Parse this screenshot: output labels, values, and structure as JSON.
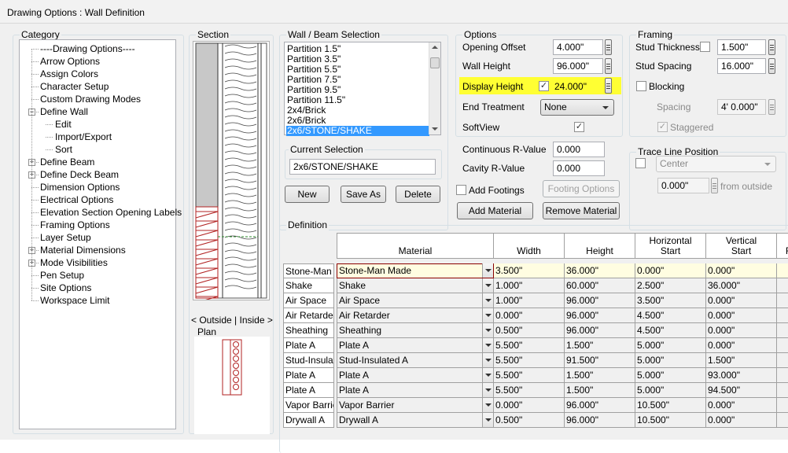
{
  "window": {
    "title": "Drawing Options : Wall Definition"
  },
  "category": {
    "label": "Category",
    "items": [
      {
        "label": "----Drawing Options----",
        "expandable": false
      },
      {
        "label": "Arrow Options",
        "expandable": false
      },
      {
        "label": "Assign Colors",
        "expandable": false
      },
      {
        "label": "Character Setup",
        "expandable": false
      },
      {
        "label": "Custom Drawing Modes",
        "expandable": false
      },
      {
        "label": "Define Wall",
        "expandable": true,
        "expanded": true
      },
      {
        "label": "Edit",
        "expandable": false,
        "child": true
      },
      {
        "label": "Import/Export",
        "expandable": false,
        "child": true
      },
      {
        "label": "Sort",
        "expandable": false,
        "child": true
      },
      {
        "label": "Define Beam",
        "expandable": true
      },
      {
        "label": "Define Deck Beam",
        "expandable": true
      },
      {
        "label": "Dimension Options",
        "expandable": false
      },
      {
        "label": "Electrical Options",
        "expandable": false
      },
      {
        "label": "Elevation Section Opening Labels",
        "expandable": false
      },
      {
        "label": "Framing Options",
        "expandable": false
      },
      {
        "label": "Layer Setup",
        "expandable": false
      },
      {
        "label": "Material Dimensions",
        "expandable": true
      },
      {
        "label": "Mode Visibilities",
        "expandable": true
      },
      {
        "label": "Pen Setup",
        "expandable": false
      },
      {
        "label": "Site Options",
        "expandable": false
      },
      {
        "label": "Workspace Limit",
        "expandable": false
      }
    ]
  },
  "section": {
    "label": "Section",
    "outside_inside": "< Outside  |  Inside >",
    "plan_label": "Plan"
  },
  "wall_beam": {
    "label": "Wall / Beam Selection",
    "items": [
      "Partition 1.5\"",
      "Partition 3.5\"",
      "Partition 5.5\"",
      "Partition 7.5\"",
      "Partition 9.5\"",
      "Partition 11.5\"",
      "2x4/Brick",
      "2x6/Brick",
      "2x6/STONE/SHAKE"
    ],
    "selected_index": 8,
    "current_selection_label": "Current Selection",
    "current_selection_value": "2x6/STONE/SHAKE",
    "new_label": "New",
    "save_as_label": "Save As",
    "delete_label": "Delete"
  },
  "options": {
    "label": "Options",
    "opening_offset_label": "Opening Offset",
    "opening_offset": "4.000\"",
    "wall_height_label": "Wall Height",
    "wall_height": "96.000\"",
    "display_height_label": "Display Height",
    "display_height": "24.000\"",
    "display_height_checked": true,
    "end_treatment_label": "End Treatment",
    "end_treatment": "None",
    "softview_label": "SoftView",
    "softview_checked": true
  },
  "rvalue": {
    "continuous_label": "Continuous R-Value",
    "continuous": "0.000",
    "cavity_label": "Cavity R-Value",
    "cavity": "0.000",
    "add_footings_label": "Add Footings",
    "footing_options_label": "Footing Options",
    "add_material_label": "Add Material",
    "remove_material_label": "Remove Material"
  },
  "framing": {
    "label": "Framing",
    "stud_thickness_label": "Stud Thickness",
    "stud_thickness": "1.500\"",
    "stud_spacing_label": "Stud Spacing",
    "stud_spacing": "16.000\"",
    "blocking_label": "Blocking",
    "spacing_label": "Spacing",
    "spacing": "4' 0.000\"",
    "staggered_label": "Staggered"
  },
  "trace": {
    "label": "Trace Line Position",
    "position": "Center",
    "offset": "0.000\"",
    "from_outside_label": "from outside"
  },
  "definition": {
    "label": "Definition",
    "columns": [
      "Material",
      "Width",
      "Height",
      "Horizontal\nStart",
      "Vertical\nStart",
      "F"
    ],
    "rows": [
      {
        "name": "Stone-Man",
        "material": "Stone-Man Made",
        "width": "3.500\"",
        "height": "36.000\"",
        "hstart": "0.000\"",
        "vstart": "0.000\""
      },
      {
        "name": "Shake",
        "material": "Shake",
        "width": "1.000\"",
        "height": "60.000\"",
        "hstart": "2.500\"",
        "vstart": "36.000\""
      },
      {
        "name": "Air Space",
        "material": "Air Space",
        "width": "1.000\"",
        "height": "96.000\"",
        "hstart": "3.500\"",
        "vstart": "0.000\""
      },
      {
        "name": "Air Retarder",
        "material": "Air Retarder",
        "width": "0.000\"",
        "height": "96.000\"",
        "hstart": "4.500\"",
        "vstart": "0.000\""
      },
      {
        "name": "Sheathing",
        "material": "Sheathing",
        "width": "0.500\"",
        "height": "96.000\"",
        "hstart": "4.500\"",
        "vstart": "0.000\""
      },
      {
        "name": "Plate A",
        "material": "Plate A",
        "width": "5.500\"",
        "height": "1.500\"",
        "hstart": "5.000\"",
        "vstart": "0.000\""
      },
      {
        "name": "Stud-Insulated A",
        "material": "Stud-Insulated A",
        "width": "5.500\"",
        "height": "91.500\"",
        "hstart": "5.000\"",
        "vstart": "1.500\""
      },
      {
        "name": "Plate A",
        "material": "Plate A",
        "width": "5.500\"",
        "height": "1.500\"",
        "hstart": "5.000\"",
        "vstart": "93.000\""
      },
      {
        "name": "Plate A",
        "material": "Plate A",
        "width": "5.500\"",
        "height": "1.500\"",
        "hstart": "5.000\"",
        "vstart": "94.500\""
      },
      {
        "name": "Vapor Barrier",
        "material": "Vapor Barrier",
        "width": "0.000\"",
        "height": "96.000\"",
        "hstart": "10.500\"",
        "vstart": "0.000\""
      },
      {
        "name": "Drywall A",
        "material": "Drywall A",
        "width": "0.500\"",
        "height": "96.000\"",
        "hstart": "10.500\"",
        "vstart": "0.000\""
      }
    ]
  },
  "colors": {
    "highlight": "#ffff33",
    "selection": "#3399ff",
    "brick": "#b22222",
    "selected_row": "#fffde1"
  }
}
